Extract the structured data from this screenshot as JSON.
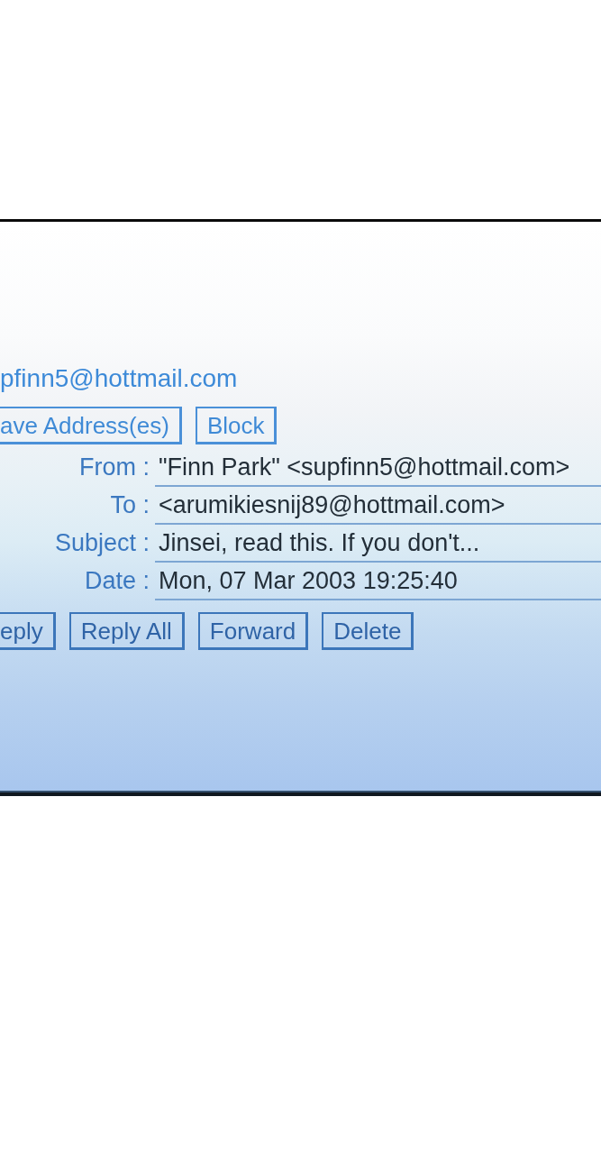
{
  "sender": {
    "address": "pfinn5@hottmail.com"
  },
  "address_actions": [
    {
      "label": "ave Address(es)"
    },
    {
      "label": "Block"
    }
  ],
  "headers": [
    {
      "label": "From :",
      "value": "\"Finn Park\" <supfinn5@hottmail.com>"
    },
    {
      "label": "To :",
      "value": "<arumikiesnij89@hottmail.com>"
    },
    {
      "label": "Subject :",
      "value": "Jinsei, read this. If you don't..."
    },
    {
      "label": "Date :",
      "value": "Mon, 07 Mar 2003 19:25:40"
    }
  ],
  "message_actions": [
    {
      "label": "eply"
    },
    {
      "label": "Reply All"
    },
    {
      "label": "Forward"
    },
    {
      "label": "Delete"
    }
  ]
}
